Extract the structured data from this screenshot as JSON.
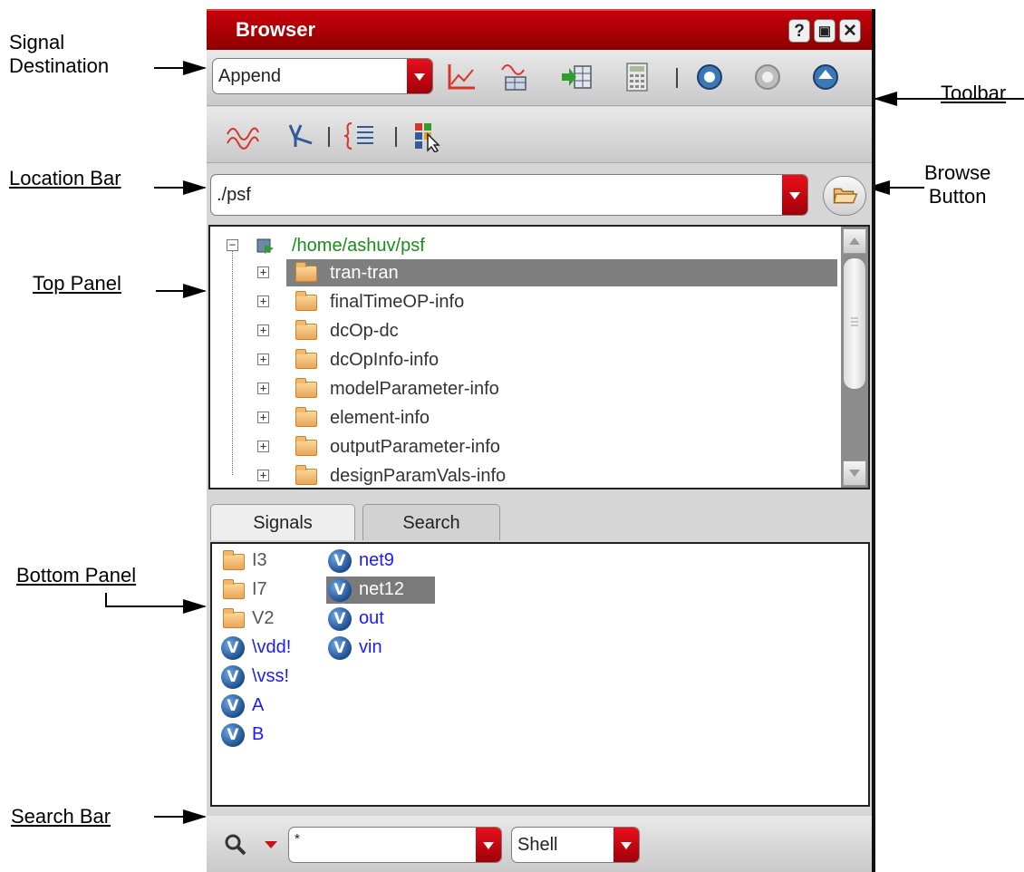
{
  "annotations": {
    "signal_destination": "Signal\nDestination",
    "toolbar": "Toolbar",
    "location_bar": "Location Bar",
    "browse_button": "Browse\nButton",
    "top_panel": "Top Panel",
    "bottom_panel": "Bottom Panel",
    "search_bar": "Search Bar"
  },
  "window": {
    "title": "Browser",
    "title_buttons": {
      "help": "?",
      "float": "▣",
      "close": "✕"
    }
  },
  "toolbar1": {
    "destination": "Append",
    "icons": [
      "plot-icon",
      "add-plot-icon",
      "table-export-icon",
      "calculator-icon",
      "back-icon",
      "forward-icon",
      "up-icon"
    ]
  },
  "toolbar2": {
    "icons": [
      "waveform-icon",
      "axis-icon",
      "list-icon",
      "select-icon"
    ]
  },
  "location": {
    "path": "./psf"
  },
  "tree": {
    "root": "/home/ashuv/psf",
    "items": [
      "tran-tran",
      "finalTimeOP-info",
      "dcOp-dc",
      "dcOpInfo-info",
      "modelParameter-info",
      "element-info",
      "outputParameter-info",
      "designParamVals-info"
    ],
    "selected": "tran-tran"
  },
  "tabs": {
    "signals": "Signals",
    "search": "Search"
  },
  "signals": {
    "col1": [
      {
        "name": "I3",
        "type": "folder"
      },
      {
        "name": "I7",
        "type": "folder"
      },
      {
        "name": "V2",
        "type": "folder"
      },
      {
        "name": "\\vdd!",
        "type": "signal"
      },
      {
        "name": "\\vss!",
        "type": "signal"
      },
      {
        "name": "A",
        "type": "signal"
      },
      {
        "name": "B",
        "type": "signal"
      }
    ],
    "col2": [
      {
        "name": "net9",
        "type": "signal"
      },
      {
        "name": "net12",
        "type": "signal"
      },
      {
        "name": "out",
        "type": "signal"
      },
      {
        "name": "vin",
        "type": "signal"
      }
    ],
    "selected": "net12",
    "signal_glyph": "V"
  },
  "search": {
    "value": "*",
    "mode": "Shell"
  }
}
